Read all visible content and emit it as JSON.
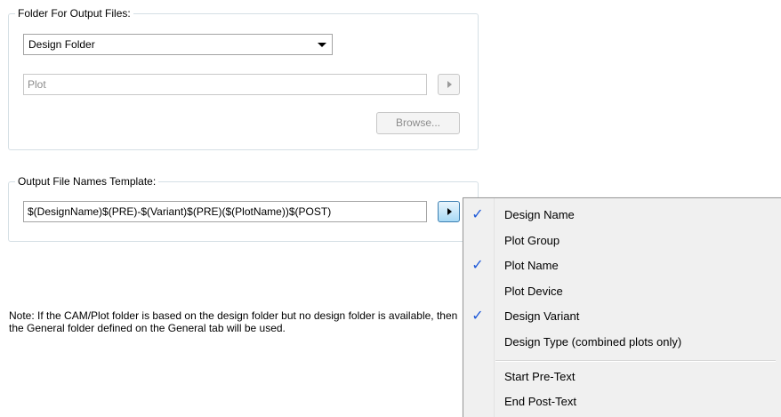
{
  "output_folder": {
    "title": "Folder For Output Files:",
    "folder_type": "Design Folder",
    "subfolder_value": "Plot",
    "browse_label": "Browse..."
  },
  "file_names": {
    "title": "Output File Names Template:",
    "template_value": "$(DesignName)$(PRE)-$(Variant)$(PRE)($(PlotName))$(POST)"
  },
  "note": "Note:  If the CAM/Plot folder is based on the design folder but no design folder is available, then the General folder defined on the General tab will be used.",
  "menu": {
    "check_glyph": "✓",
    "items": [
      {
        "label": "Design Name",
        "checked": true
      },
      {
        "label": "Plot Group",
        "checked": false
      },
      {
        "label": "Plot Name",
        "checked": true
      },
      {
        "label": "Plot Device",
        "checked": false
      },
      {
        "label": "Design Variant",
        "checked": true
      },
      {
        "label": "Design Type (combined plots only)",
        "checked": false
      },
      {
        "label": "Start Pre-Text",
        "checked": false
      },
      {
        "label": "End Post-Text",
        "checked": false
      }
    ]
  },
  "colors": {
    "check": "#1f5ad8",
    "menu_bg": "#f0f0f0",
    "group_border": "#d5dfe5"
  }
}
